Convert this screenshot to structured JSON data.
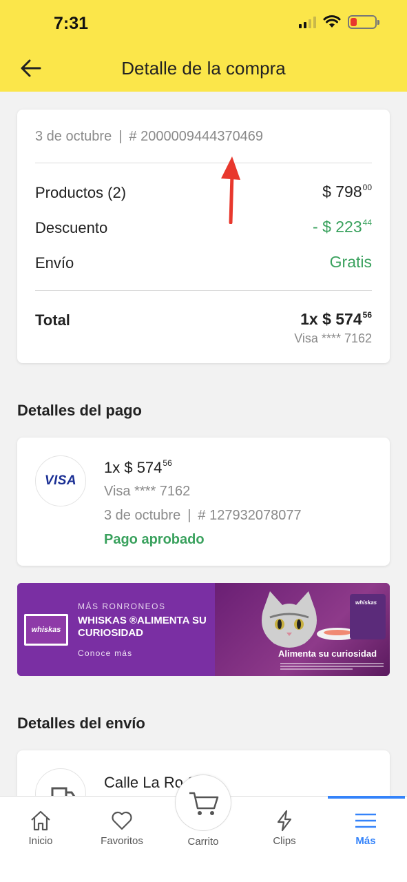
{
  "status_bar": {
    "time": "7:31"
  },
  "header": {
    "title": "Detalle de la compra"
  },
  "summary": {
    "date": "3 de octubre",
    "separator": "|",
    "order_number": "# 2000009444370469",
    "rows": [
      {
        "label": "Productos (2)",
        "value": "$ 798",
        "cents": "00"
      },
      {
        "label": "Descuento",
        "value": "- $ 223",
        "cents": "44"
      },
      {
        "label": "Envío",
        "value": "Gratis",
        "cents": ""
      }
    ],
    "total": {
      "label": "Total",
      "value": "1x $ 574",
      "cents": "56",
      "payment": "Visa **** 7162"
    }
  },
  "payment_section": {
    "title": "Detalles del pago",
    "card_brand": "VISA",
    "amount": "1x $ 574",
    "cents": "56",
    "card": "Visa **** 7162",
    "date": "3 de octubre",
    "separator": "|",
    "operation": "# 127932078077",
    "status": "Pago aprobado"
  },
  "banner": {
    "eyebrow": "MÁS RONRONEOS",
    "headline": "WHISKAS ®ALIMENTA SU CURIOSIDAD",
    "cta": "Conoce más",
    "brand": "whiskas",
    "tagline": "Alimenta su curiosidad"
  },
  "shipping_section": {
    "title": "Detalles del envío",
    "address": "Calle La Ro      902"
  },
  "bottom_nav": {
    "items": [
      {
        "label": "Inicio",
        "icon": "home-icon"
      },
      {
        "label": "Favoritos",
        "icon": "heart-icon"
      },
      {
        "label": "Carrito",
        "icon": "cart-icon"
      },
      {
        "label": "Clips",
        "icon": "lightning-icon"
      },
      {
        "label": "Más",
        "icon": "menu-icon",
        "active": true
      }
    ]
  },
  "colors": {
    "header": "#fbe64a",
    "green": "#39a15d",
    "accent": "#3483fa",
    "annotation": "#e8382d"
  }
}
